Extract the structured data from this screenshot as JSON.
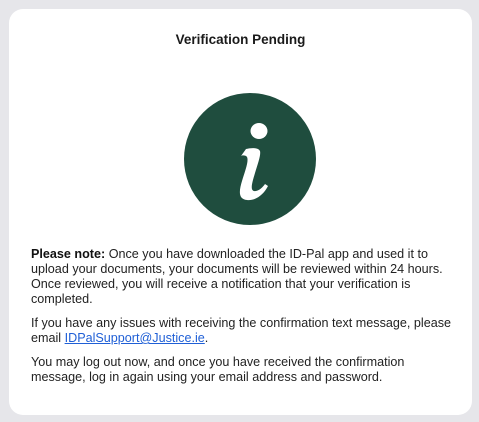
{
  "dialog": {
    "title": "Verification Pending",
    "icon": "info-icon",
    "icon_bg_color": "#1f4d3e",
    "icon_fg_color": "#ffffff"
  },
  "message": {
    "note_label": "Please note:",
    "note_text": " Once you have downloaded the ID-Pal app and used it to upload your documents, your documents will be reviewed within 24 hours. Once reviewed, you will receive a notification that your verification is completed.",
    "issues_text": "If you have any issues with receiving the confirmation text message, please email ",
    "support_email": "IDPalSupport@Justice.ie",
    "issues_suffix": ".",
    "logout_text": "You may log out now, and once you have received the confirmation message, log in again using your email address and password."
  }
}
